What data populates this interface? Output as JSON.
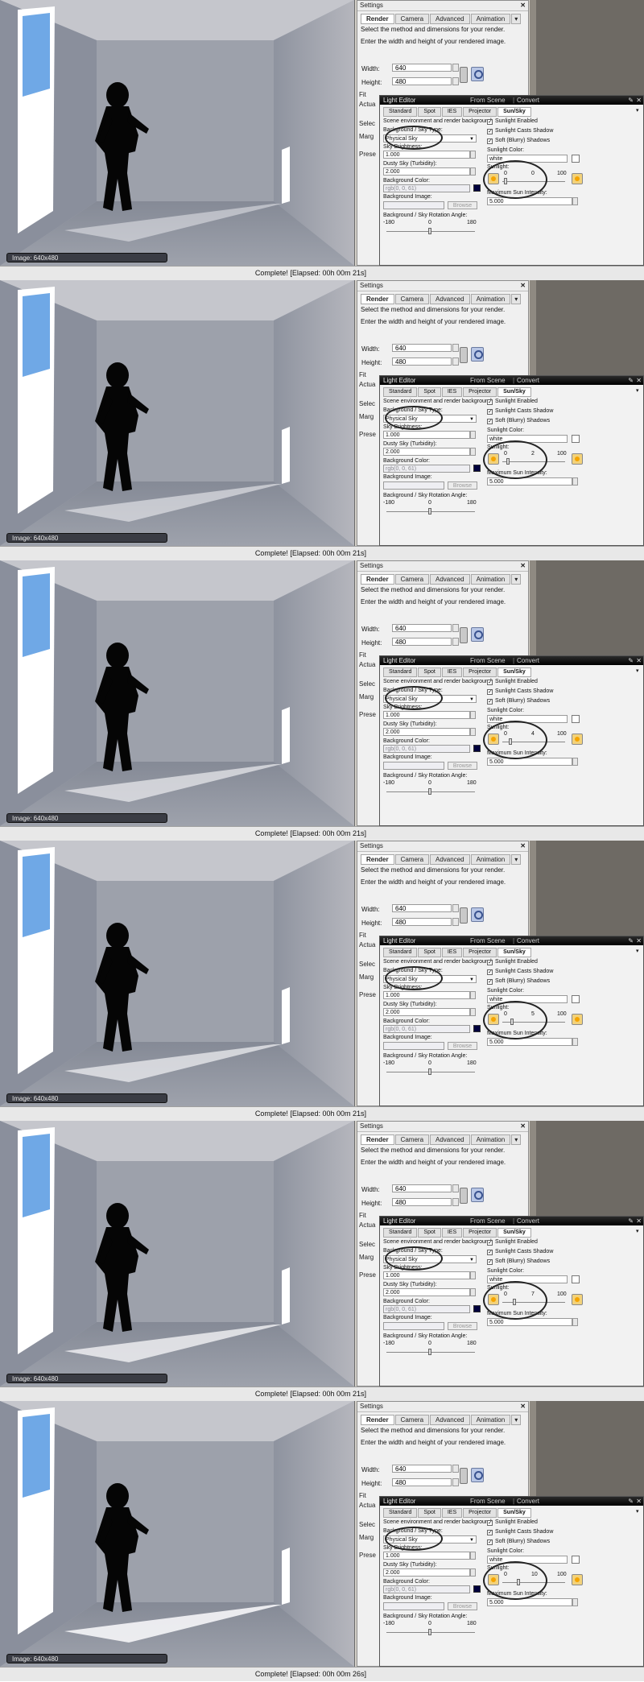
{
  "settings": {
    "title": "Settings",
    "close": "✕",
    "tabs": [
      "Render",
      "Camera",
      "Advanced",
      "Animation"
    ],
    "more": "▾",
    "description_method": "Select the method and dimensions for your render.",
    "description_size": "Enter the width and height of your rendered image.",
    "width_label": "Width:",
    "width_value": "640",
    "height_label": "Height:",
    "height_value": "480",
    "hidden_fit": "Fit",
    "hidden_actual": "Actua",
    "hidden_select": "Selec",
    "hidden_marg": "Marg",
    "hidden_pres": "Prese"
  },
  "light_editor": {
    "title": "Light Editor",
    "from_scene": "From Scene",
    "separator": "|",
    "convert": "Convert",
    "pen_icon": "✎",
    "close_icon": "✕",
    "tabs": [
      "Standard",
      "Spot",
      "IES",
      "Projector",
      "Sun/Sky"
    ],
    "more": "▾",
    "scene_desc": "Scene environment and render background",
    "sky_type_label": "Background / Sky Type:",
    "sky_type_value": "Physical Sky",
    "sky_brightness_label": "Sky Brightness:",
    "sky_brightness_value": "1.000",
    "dusty_label": "Dusty Sky (Turbidity):",
    "dusty_value": "2.000",
    "bg_color_label": "Background Color:",
    "bg_color_value": "rgb(0, 0, 61)",
    "bg_image_label": "Background Image:",
    "browse": "Browse",
    "rotation_label": "Background / Sky Rotation Angle:",
    "rot_min": "-180",
    "rot_mid": "0",
    "rot_max": "180",
    "sunlight_enabled": "Sunlight Enabled",
    "casts_shadow": "Sunlight Casts Shadow",
    "soft_shadows": "Soft (Blurry) Shadows",
    "sun_color_label": "Sunlight Color:",
    "sun_color_value": "white",
    "sunlight_label": "Sunlight:",
    "sun_min": "0",
    "sun_max": "100",
    "max_intensity_label": "Maximum Sun Intensity:",
    "max_intensity_value": "5.000",
    "check": "✓"
  },
  "frames": [
    {
      "image_label": "Image: 640x480",
      "status": "Complete!  [Elapsed: 00h 00m 21s]",
      "sunlight": "0"
    },
    {
      "image_label": "Image: 640x480",
      "status": "Complete!  [Elapsed: 00h 00m 21s]",
      "sunlight": "2"
    },
    {
      "image_label": "Image: 640x480",
      "status": "Complete!  [Elapsed: 00h 00m 21s]",
      "sunlight": "4"
    },
    {
      "image_label": "Image: 640x480",
      "status": "Complete!  [Elapsed: 00h 00m 21s]",
      "sunlight": "5"
    },
    {
      "image_label": "Image: 640x480",
      "status": "Complete!  [Elapsed: 00h 00m 21s]",
      "sunlight": "7"
    },
    {
      "image_label": "Image: 640x480",
      "status": "Complete!  [Elapsed: 00h 00m 26s]",
      "sunlight": "10"
    }
  ],
  "colors": {
    "sky_window": "#6fa8e6",
    "swatch": "#00003d",
    "title_bar": "#000000"
  }
}
